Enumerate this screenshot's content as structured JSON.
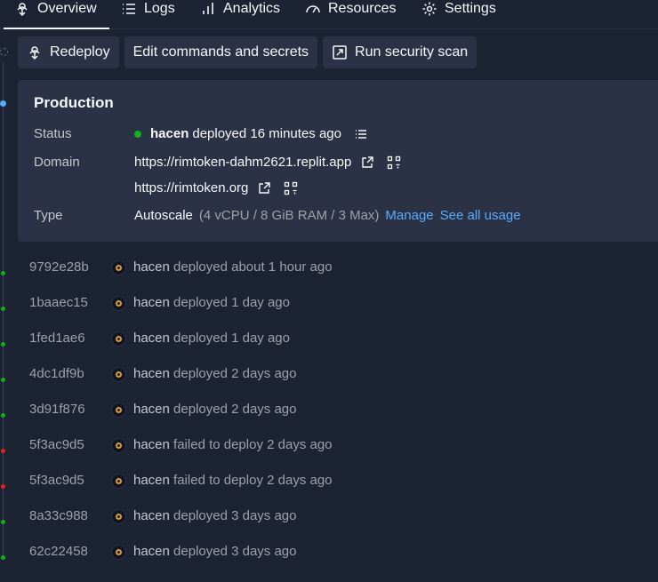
{
  "tabs": [
    {
      "label": "Overview",
      "icon": "rocket-icon"
    },
    {
      "label": "Logs",
      "icon": "list-icon"
    },
    {
      "label": "Analytics",
      "icon": "bar-chart-icon"
    },
    {
      "label": "Resources",
      "icon": "gauge-icon"
    },
    {
      "label": "Settings",
      "icon": "gear-icon"
    }
  ],
  "actions": {
    "redeploy": "Redeploy",
    "edit_commands": "Edit commands and secrets",
    "security_scan": "Run security scan"
  },
  "production": {
    "title": "Production",
    "status_label": "Status",
    "status_user": "hacen",
    "status_text": "deployed 16 minutes ago",
    "domain_label": "Domain",
    "domain_1": "https://rimtoken-dahm2621.replit.app",
    "domain_2": "https://rimtoken.org",
    "type_label": "Type",
    "type_value": "Autoscale",
    "type_specs": "(4 vCPU / 8 GiB RAM / 3 Max)",
    "manage_link": "Manage",
    "usage_link": "See all usage"
  },
  "colors": {
    "success": "#0fb21a",
    "failed": "#e52222",
    "accent": "#57abff"
  },
  "deployments": [
    {
      "hash": "9792e28b",
      "user": "hacen",
      "text": "deployed about 1 hour ago",
      "status": "success"
    },
    {
      "hash": "1baaec15",
      "user": "hacen",
      "text": "deployed 1 day ago",
      "status": "success"
    },
    {
      "hash": "1fed1ae6",
      "user": "hacen",
      "text": "deployed 1 day ago",
      "status": "success"
    },
    {
      "hash": "4dc1df9b",
      "user": "hacen",
      "text": "deployed 2 days ago",
      "status": "success"
    },
    {
      "hash": "3d91f876",
      "user": "hacen",
      "text": "deployed 2 days ago",
      "status": "success"
    },
    {
      "hash": "5f3ac9d5",
      "user": "hacen",
      "text": "failed to deploy 2 days ago",
      "status": "failed"
    },
    {
      "hash": "5f3ac9d5",
      "user": "hacen",
      "text": "failed to deploy 2 days ago",
      "status": "failed"
    },
    {
      "hash": "8a33c988",
      "user": "hacen",
      "text": "deployed 3 days ago",
      "status": "success"
    },
    {
      "hash": "62c22458",
      "user": "hacen",
      "text": "deployed 3 days ago",
      "status": "success"
    }
  ]
}
